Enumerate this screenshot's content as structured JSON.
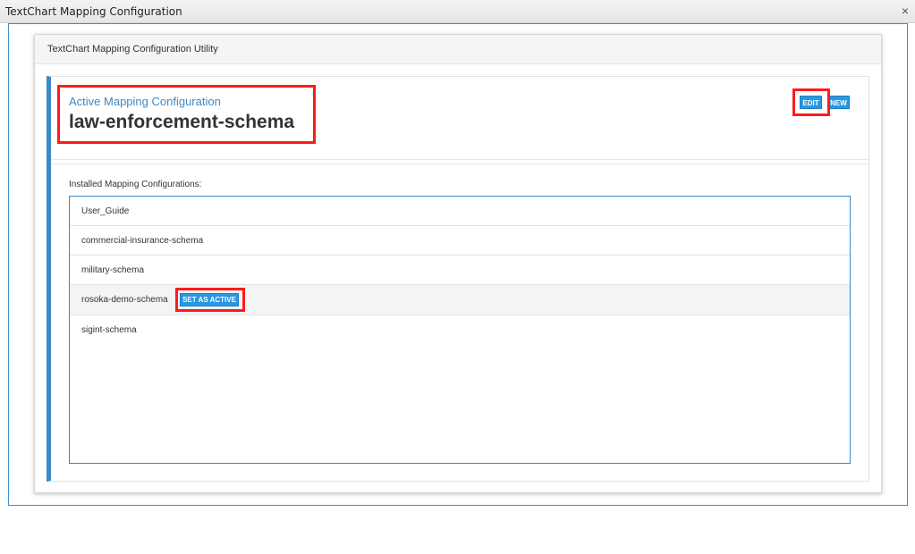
{
  "window": {
    "title": "TextChart Mapping Configuration",
    "close_glyph": "×"
  },
  "card": {
    "header": "TextChart Mapping Configuration Utility"
  },
  "active": {
    "label": "Active Mapping Configuration",
    "name": "law-enforcement-schema"
  },
  "buttons": {
    "edit": "EDIT",
    "new": "NEW",
    "set_active": "SET AS ACTIVE"
  },
  "installed": {
    "label": "Installed Mapping Configurations:",
    "items": [
      "User_Guide",
      "commercial-insurance-schema",
      "military-schema",
      "rosoka-demo-schema",
      "sigint-schema"
    ],
    "selected_index": 3
  },
  "colors": {
    "accent": "#3b88c5",
    "button": "#2a97e0",
    "highlight": "#ff1a1a"
  }
}
